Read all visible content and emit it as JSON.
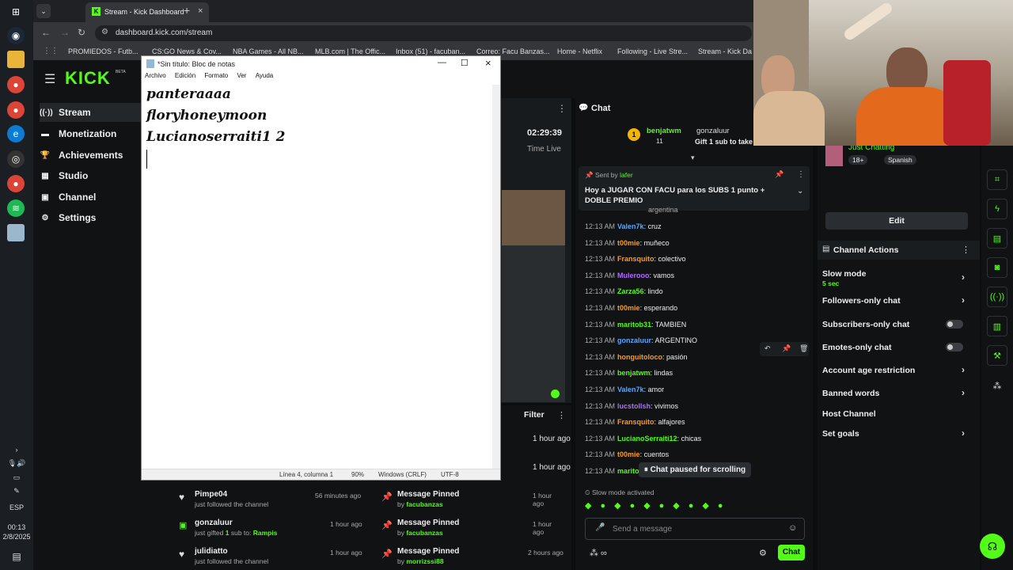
{
  "browser": {
    "tab_title": "Stream - Kick Dashboard",
    "url": "dashboard.kick.com/stream",
    "bookmarks": [
      "PROMIEDOS - Futb...",
      "CS:GO News & Cov...",
      "NBA Games - All NB...",
      "MLB.com | The Offic...",
      "Inbox (51) - facuban...",
      "Correo: Facu Banzas...",
      "Home - Netflix",
      "Following - Live Stre...",
      "Stream - Kick Da"
    ]
  },
  "kick": {
    "logo": "KICK",
    "beta": "BETA",
    "nav": [
      {
        "label": "Stream",
        "icon": "radio-icon"
      },
      {
        "label": "Monetization",
        "icon": "money-icon"
      },
      {
        "label": "Achievements",
        "icon": "trophy-icon"
      },
      {
        "label": "Studio",
        "icon": "studio-icon"
      },
      {
        "label": "Channel",
        "icon": "channel-icon"
      },
      {
        "label": "Settings",
        "icon": "gear-icon"
      }
    ],
    "uptime": "02:29:39",
    "uptime_label": "Time Live",
    "filter_label": "Filter",
    "brand_color": "#53fc18"
  },
  "notepad": {
    "title": "*Sin título: Bloc de notas",
    "menu": [
      "Archivo",
      "Edición",
      "Formato",
      "Ver",
      "Ayuda"
    ],
    "lines": [
      "panteraaaa",
      "floryhoneymoon",
      "Lucianoserraiti1 2"
    ],
    "status": {
      "position": "Línea 4, columna 1",
      "zoom": "90%",
      "eol": "Windows (CRLF)",
      "encoding": "UTF-8"
    }
  },
  "activity_left": [
    {
      "title": "Pimpe04",
      "sub": "just followed the channel",
      "time": "56 minutes ago",
      "icon": "heart-icon"
    },
    {
      "title": "gonzaluur",
      "sub_prefix": "just gifted ",
      "count": "1",
      "sub_mid": " sub to: ",
      "target": "Rampis",
      "time": "1 hour ago",
      "icon": "gift-icon"
    },
    {
      "title": "julidiatto",
      "sub": "just followed the channel",
      "time": "1 hour ago",
      "icon": "heart-icon"
    }
  ],
  "activity_right": [
    {
      "title": "Message Pinned",
      "by": "by ",
      "user": "facubanzas",
      "time": "1 hour ago"
    },
    {
      "title": "Message Pinned",
      "by": "by ",
      "user": "facubanzas",
      "time": "1 hour ago"
    },
    {
      "title": "Message Pinned",
      "by": "by ",
      "user": "morrizssi88",
      "time": "2 hours ago"
    }
  ],
  "activity_times_top": [
    "1 hour ago",
    "1 hour ago"
  ],
  "chat": {
    "header": "Chat",
    "gifter": {
      "rank": "1",
      "name": "benjatwm",
      "count": "11"
    },
    "gift_user": "gonzaluur",
    "gift_text": "Gift 1 sub to take 3",
    "pinned": {
      "sent_by": "Sent by ",
      "user": "lafer",
      "text": "Hoy a JUGAR CON FACU para los SUBS 1 punto + DOBLE PREMIO"
    },
    "partial": "argentina",
    "messages": [
      {
        "time": "12:13 AM",
        "user": "Valen7k",
        "text": ": cruz",
        "color": "#5aa7ff"
      },
      {
        "time": "12:13 AM",
        "user": "t00mie",
        "text": ": muñeco",
        "color": "#ff9a1f"
      },
      {
        "time": "12:13 AM",
        "user": "Fransquito",
        "text": ": colectivo",
        "color": "#ff9a1f"
      },
      {
        "time": "12:13 AM",
        "user": "Mulerooo",
        "text": ": vamos",
        "color": "#b36bff"
      },
      {
        "time": "12:13 AM",
        "user": "Zarza56",
        "text": ": lindo",
        "color": "#53fc18"
      },
      {
        "time": "12:13 AM",
        "user": "t00mie",
        "text": ": esperando",
        "color": "#ff9a1f"
      },
      {
        "time": "12:13 AM",
        "user": "maritob31",
        "text": ": TAMBIEN",
        "color": "#53fc18"
      },
      {
        "time": "12:13 AM",
        "user": "gonzaluur",
        "text": ": ARGENTINO",
        "color": "#5aa7ff"
      },
      {
        "time": "12:13 AM",
        "user": "honguitoloco",
        "text": ": pasión",
        "color": "#ff9a1f"
      },
      {
        "time": "12:13 AM",
        "user": "benjatwm",
        "text": ": lindas",
        "color": "#53fc18"
      },
      {
        "time": "12:13 AM",
        "user": "Valen7k",
        "text": ": amor",
        "color": "#5aa7ff"
      },
      {
        "time": "12:13 AM",
        "user": "lucstollsh",
        "text": ": vivimos",
        "color": "#b36bff"
      },
      {
        "time": "12:13 AM",
        "user": "Fransquito",
        "text": ": alfajores",
        "color": "#ff9a1f"
      },
      {
        "time": "12:13 AM",
        "user": "LucianoSerraiti12",
        "text": ": chicas",
        "color": "#53fc18"
      },
      {
        "time": "12:13 AM",
        "user": "t00mie",
        "text": ": cuentos",
        "color": "#ff9a1f"
      },
      {
        "time": "12:13 AM",
        "user": "maritob",
        "text": "",
        "color": "#53fc18"
      }
    ],
    "paused": "Chat paused for scrolling",
    "slow_mode_notice": "Slow mode activated",
    "input_placeholder": "Send a message",
    "send_label": "Chat"
  },
  "channel": {
    "category": "Just Chatting",
    "tags": [
      "18+",
      "Spanish"
    ],
    "edit_label": "Edit",
    "actions_title": "Channel Actions",
    "actions": [
      {
        "label": "Slow mode",
        "sub": "5 sec",
        "control": "chevron"
      },
      {
        "label": "Followers-only chat",
        "control": "chevron"
      },
      {
        "label": "Subscribers-only chat",
        "control": "toggle",
        "on": false
      },
      {
        "label": "Emotes-only chat",
        "control": "toggle",
        "on": false
      },
      {
        "label": "Account age restriction",
        "control": "chevron"
      },
      {
        "label": "Banned words",
        "control": "chevron"
      },
      {
        "label": "Host Channel",
        "control": "none"
      },
      {
        "label": "Set goals",
        "control": "chevron"
      }
    ]
  },
  "system": {
    "lang": "ESP",
    "time": "00:13",
    "date": "2/8/2025"
  }
}
